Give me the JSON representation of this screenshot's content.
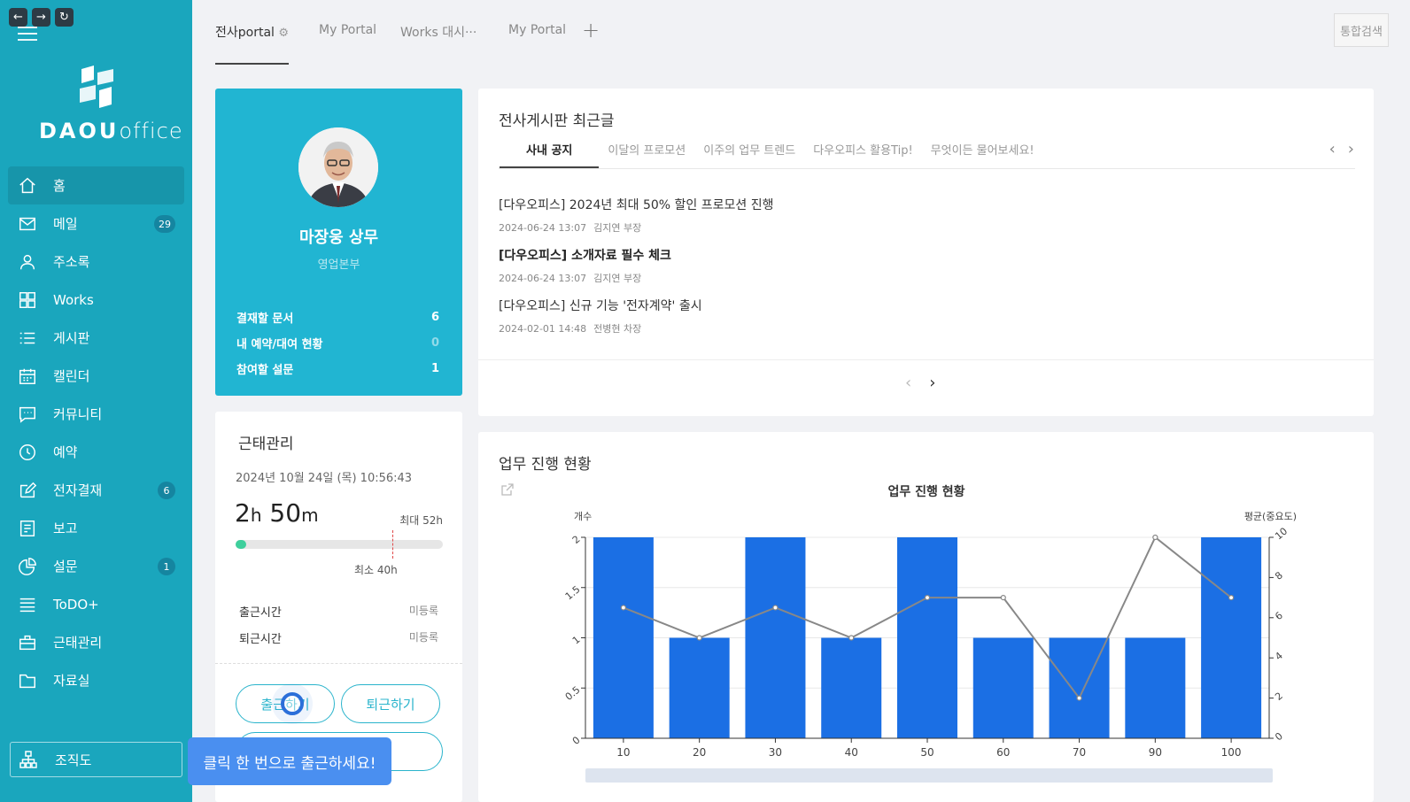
{
  "sidebar": {
    "logo": {
      "brand": "DAOU",
      "suffix": "office"
    },
    "items": [
      {
        "label": "홈",
        "icon": "home-icon",
        "badge": ""
      },
      {
        "label": "메일",
        "icon": "mail-icon",
        "badge": "29"
      },
      {
        "label": "주소록",
        "icon": "person-icon",
        "badge": ""
      },
      {
        "label": "Works",
        "icon": "grid-icon",
        "badge": ""
      },
      {
        "label": "게시판",
        "icon": "list-icon",
        "badge": ""
      },
      {
        "label": "캘린더",
        "icon": "calendar-icon",
        "badge": ""
      },
      {
        "label": "커뮤니티",
        "icon": "chat-icon",
        "badge": ""
      },
      {
        "label": "예약",
        "icon": "clock-icon",
        "badge": ""
      },
      {
        "label": "전자결재",
        "icon": "edit-icon",
        "badge": "6"
      },
      {
        "label": "보고",
        "icon": "report-icon",
        "badge": ""
      },
      {
        "label": "설문",
        "icon": "pie-icon",
        "badge": "1"
      },
      {
        "label": "ToDO+",
        "icon": "stack-icon",
        "badge": ""
      },
      {
        "label": "근태관리",
        "icon": "briefcase-icon",
        "badge": ""
      },
      {
        "label": "자료실",
        "icon": "folder-icon",
        "badge": ""
      }
    ],
    "org_label": "조직도"
  },
  "tabs": [
    {
      "label": "전사portal"
    },
    {
      "label": "My Portal"
    },
    {
      "label": "Works 대시···"
    },
    {
      "label": "My Portal"
    }
  ],
  "search_label": "통합검색",
  "profile": {
    "name": "마장웅 상무",
    "dept": "영업본부",
    "stats": [
      {
        "label": "결재할 문서",
        "value": "6"
      },
      {
        "label": "내 예약/대여 현황",
        "value": "0"
      },
      {
        "label": "참여할 설문",
        "value": "1"
      }
    ]
  },
  "attendance": {
    "title": "근태관리",
    "date": "2024년 10월 24일 (목) 10:56:43",
    "hours": "2",
    "hours_unit": "h",
    "minutes": "50",
    "minutes_unit": "m",
    "max_label": "최대 52h",
    "min_label": "최소 40h",
    "progress": 0.05,
    "checkin_label": "출근시간",
    "checkin_value": "미등록",
    "checkout_label": "퇴근시간",
    "checkout_value": "미등록",
    "checkin_button": "출근하기",
    "checkout_button": "퇴근하기",
    "tooltip": "클릭 한 번으로 출근하세요!"
  },
  "board": {
    "title": "전사게시판 최근글",
    "tabs": [
      "사내 공지",
      "이달의 프로모션",
      "이주의 업무 트렌드",
      "다우오피스 활용Tip!",
      "무엇이든 물어보세요!"
    ],
    "posts": [
      {
        "title": "[다우오피스] 2024년 최대 50% 할인 프로모션 진행",
        "date": "2024-06-24 13:07",
        "author": "김지연 부장",
        "bold": false
      },
      {
        "title": "[다우오피스] 소개자료 필수 체크",
        "date": "2024-06-24 13:07",
        "author": "김지연 부장",
        "bold": true
      },
      {
        "title": "[다우오피스] 신규 기능 '전자계약' 출시",
        "date": "2024-02-01 14:48",
        "author": "전병현 차장",
        "bold": false
      }
    ]
  },
  "chart_section_title": "업무 진행 현황",
  "chart_data": {
    "type": "bar",
    "title": "업무 진행 현황",
    "ylabel": "개수",
    "y2label": "평균(중요도)",
    "categories": [
      "10",
      "20",
      "30",
      "40",
      "50",
      "60",
      "70",
      "90",
      "100"
    ],
    "series": [
      {
        "values": [
          2,
          1,
          2,
          1,
          2,
          1,
          1,
          1,
          2
        ],
        "color": "#1b6fe4",
        "axis": "left",
        "kind": "bar"
      },
      {
        "values": [
          6.5,
          5,
          6.5,
          5,
          7,
          7,
          2,
          10,
          7
        ],
        "color": "#888888",
        "axis": "right",
        "kind": "line"
      }
    ],
    "ylim": [
      0,
      2
    ],
    "y2lim": [
      0,
      10
    ],
    "yticks": [
      "0",
      "0.5",
      "1",
      "1.5",
      "2"
    ],
    "y2ticks": [
      "0",
      "2",
      "4",
      "6",
      "8",
      "10"
    ],
    "grid": true
  }
}
